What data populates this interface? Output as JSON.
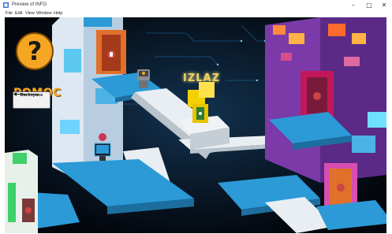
{
  "window": {
    "title": "Preview of INFO",
    "controls": {
      "minimize": "–",
      "maximize": "□",
      "close": "✕"
    }
  },
  "menu": [
    "File",
    "Edit",
    "View",
    "Window",
    "Help"
  ],
  "scene": {
    "help_label": "POMOC",
    "help_symbol": "?",
    "backspace_label": "Backspace",
    "exit_label": "IZLAZ"
  },
  "icons": [
    "app-icon",
    "question-mark-icon",
    "arrow-left-icon",
    "robot-icon",
    "computer-icon",
    "exit-door-icon",
    "locked-door-icon"
  ],
  "colors": {
    "background": "#05080f",
    "platform": "#2b9ad6",
    "help": "#f5a623",
    "exit_text": "#f2d15a",
    "tower_right": "#7b3aa8"
  }
}
